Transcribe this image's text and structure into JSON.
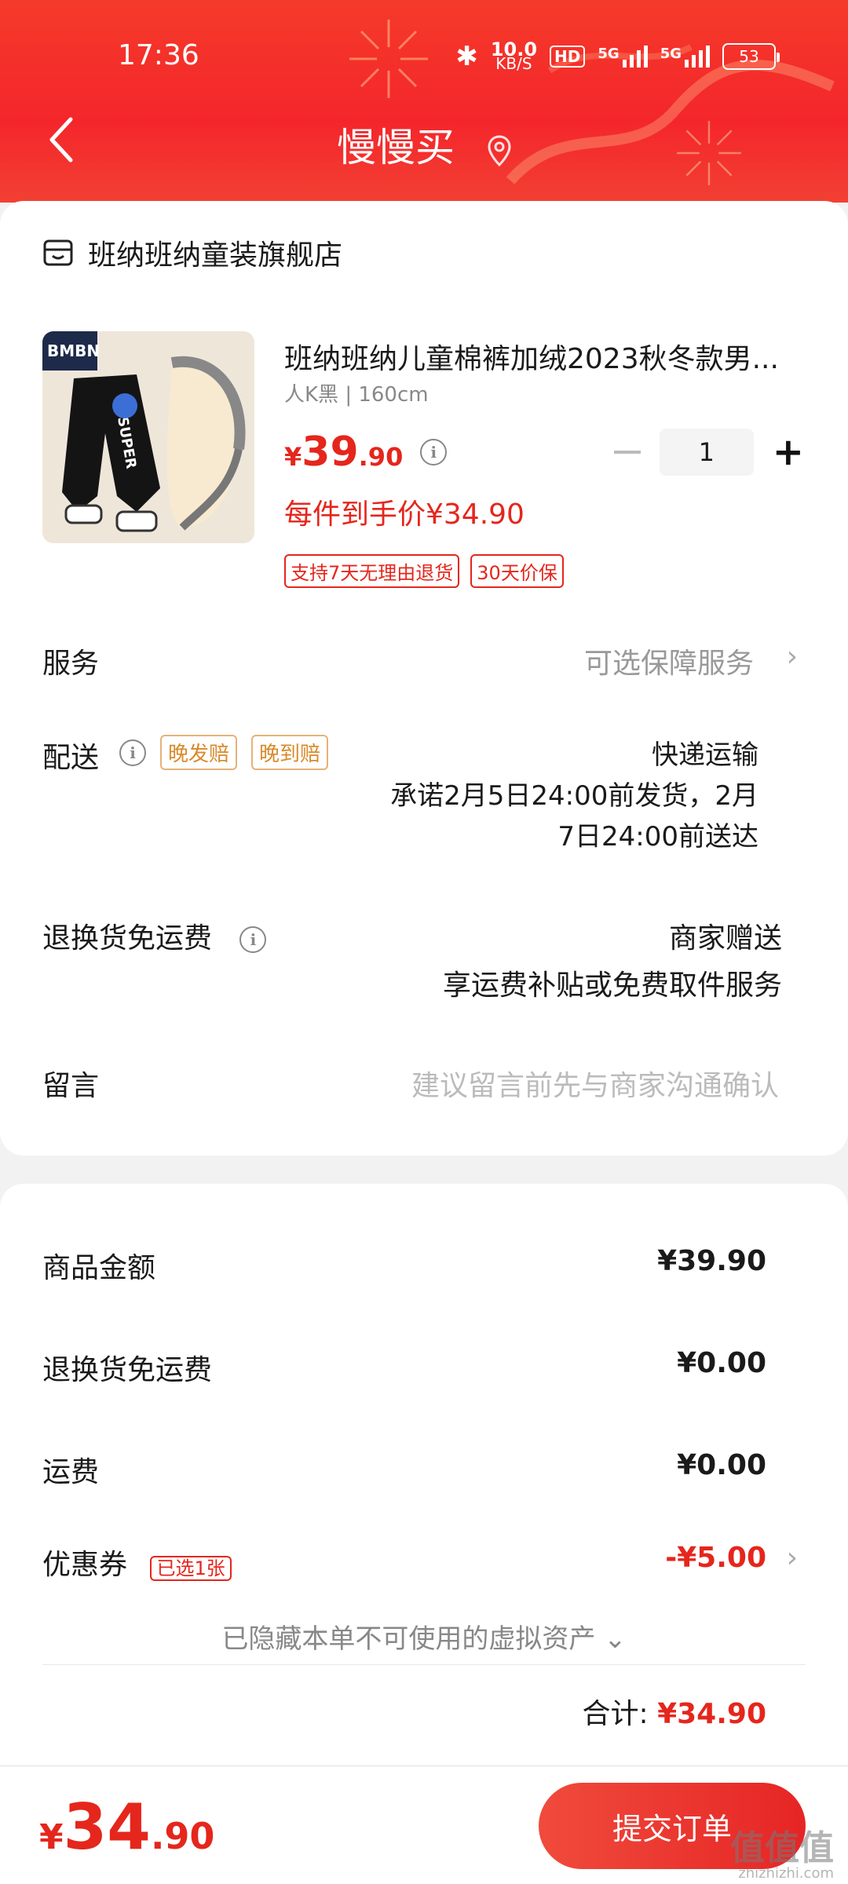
{
  "status_bar": {
    "time": "17:36",
    "net_speed": "10.0",
    "net_unit": "KB/S",
    "hd": "HD",
    "sim1": "5G",
    "sim2": "5G",
    "battery": "53"
  },
  "header": {
    "title": "慢慢买"
  },
  "shop": {
    "name": "班纳班纳童装旗舰店"
  },
  "product": {
    "title": "班纳班纳儿童棉裤加绒2023秋冬款男...",
    "spec": "人K黑 | 160cm",
    "price_symbol": "¥",
    "price_int": "39",
    "price_dec": ".90",
    "final_price": "每件到手价¥34.90",
    "quantity": "1",
    "tags": [
      "支持7天无理由退货",
      "30天价保"
    ],
    "image_text": {
      "brand": "BMBN",
      "print": "SUPER"
    }
  },
  "service": {
    "label": "服务",
    "value": "可选保障服务"
  },
  "delivery": {
    "label": "配送",
    "tags": [
      "晚发赔",
      "晚到赔"
    ],
    "method": "快递运输",
    "promise_line1": "承诺2月5日24:00前发货，2月",
    "promise_line2": "7日24:00前送达"
  },
  "return_shipping": {
    "label": "退换货免运费",
    "value1": "商家赠送",
    "value2": "享运费补贴或免费取件服务"
  },
  "memo": {
    "label": "留言",
    "placeholder": "建议留言前先与商家沟通确认"
  },
  "summary": {
    "goods_amount_label": "商品金额",
    "goods_amount": "¥39.90",
    "return_fee_label": "退换货免运费",
    "return_fee": "¥0.00",
    "shipping_label": "运费",
    "shipping": "¥0.00",
    "coupon_label": "优惠券",
    "coupon_tag": "已选1张",
    "coupon_value": "-¥5.00",
    "hidden_note": "已隐藏本单不可使用的虚拟资产",
    "total_label": "合计:",
    "total_value": "¥34.90"
  },
  "bottom": {
    "price_symbol": "¥",
    "price_int": "34",
    "price_dec": ".90",
    "submit_label": "提交订单"
  },
  "watermark": {
    "text": "值值值",
    "url": "zhizhizhi.com"
  },
  "colors": {
    "brand_red": "#e5261c",
    "header_red": "#f4262b",
    "gold_tag": "#d88a2a"
  }
}
